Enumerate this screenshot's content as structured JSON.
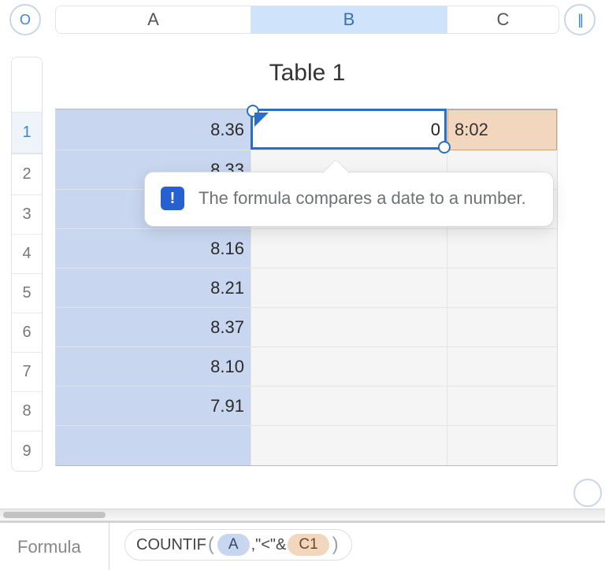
{
  "toolbar": {
    "left_icon": "O",
    "right_icon": "||"
  },
  "columns": {
    "A": "A",
    "B": "B",
    "C": "C"
  },
  "rows": {
    "r1": "1",
    "r2": "2",
    "r3": "3",
    "r4": "4",
    "r5": "5",
    "r6": "6",
    "r7": "7",
    "r8": "8",
    "r9": "9"
  },
  "table": {
    "title": "Table 1",
    "A": {
      "r1": "8.36",
      "r2": "8.33",
      "r3": "",
      "r4": "8.16",
      "r5": "8.21",
      "r6": "8.37",
      "r7": "8.10",
      "r8": "7.91",
      "r9": ""
    },
    "B": {
      "r1": "0"
    },
    "C": {
      "r1": "8:02"
    }
  },
  "tooltip": {
    "badge": "!",
    "text": "The formula compares a date to a number."
  },
  "formula": {
    "label": "Formula",
    "func": "COUNTIF",
    "argA": "A",
    "literal": ",\"<\"&",
    "argC": "C1"
  }
}
